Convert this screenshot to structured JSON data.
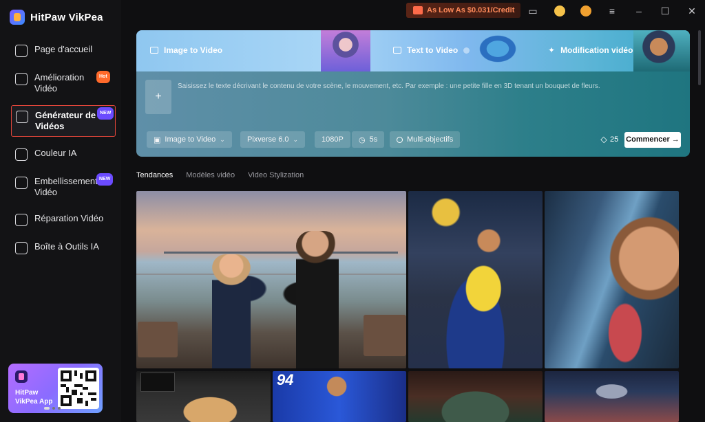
{
  "app": {
    "name": "HitPaw VikPea"
  },
  "sidebar": {
    "items": [
      {
        "label": "Page d'accueil",
        "badge": ""
      },
      {
        "label": "Amélioration\nVidéo",
        "badge": "Hot"
      },
      {
        "label": "Générateur de\nVidéos",
        "badge": "NEW",
        "active": true
      },
      {
        "label": "Couleur IA",
        "badge": ""
      },
      {
        "label": "Embellissement\nVidéo",
        "badge": "NEW"
      },
      {
        "label": "Réparation Vidéo",
        "badge": ""
      },
      {
        "label": "Boîte à Outils IA",
        "badge": ""
      }
    ],
    "app_card": {
      "label": "HitPaw\nVikPea App"
    }
  },
  "titlebar": {
    "promo": "As Low As $0.031/Credit",
    "icons": [
      "message-icon",
      "coin-icon",
      "user-avatar-icon",
      "menu-icon",
      "minimize-icon",
      "maximize-icon",
      "close-icon"
    ]
  },
  "hero": {
    "tabs": [
      "Image to Video",
      "Text to Video",
      "Modification vidéo"
    ],
    "add_label": "+",
    "prompt_placeholder": "Saisissez le texte décrivant le contenu de votre scène, le mouvement, etc. Par exemple : une petite fille en 3D tenant un bouquet de fleurs.",
    "controls": {
      "mode": "Image to Video",
      "model": "Pixverse 6.0",
      "resolution": "1080P",
      "duration": "5s",
      "multi": "Multi-objectifs"
    },
    "credits": "25",
    "start": "Commencer →"
  },
  "categories": [
    "Tendances",
    "Modèles vidéo",
    "Video Stylization"
  ],
  "gallery": {
    "tile5_text": "94"
  },
  "colors": {
    "accent_active_border": "#e0453a",
    "badge_hot": "#ff6a2b",
    "badge_new": "#6b4bff",
    "promo_text": "#ff8a5a"
  }
}
